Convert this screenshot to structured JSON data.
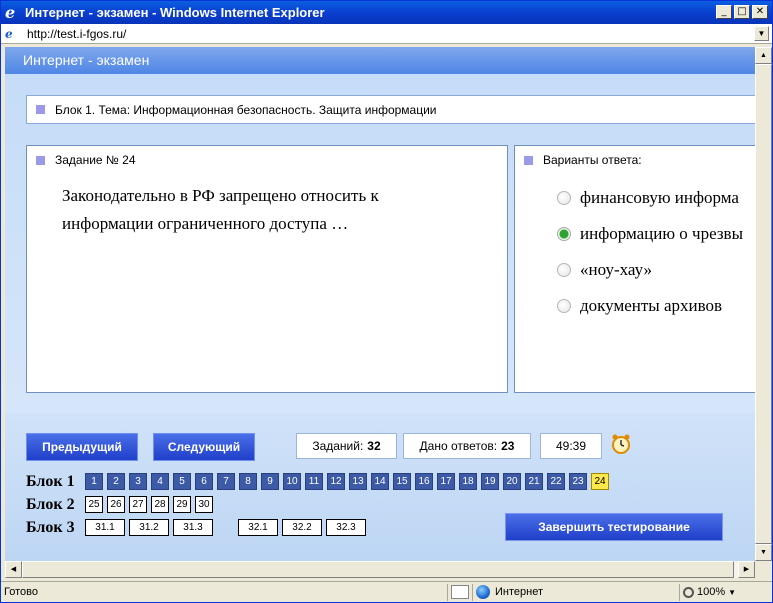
{
  "window": {
    "title": "Интернет - экзамен - Windows Internet Explorer",
    "address": "http://test.i-fgos.ru/"
  },
  "app": {
    "header": "Интернет - экзамен",
    "block_title": "Блок 1. Тема: Информационная безопасность. Защита информации"
  },
  "task": {
    "label": "Задание № 24",
    "question_line1": "Законодательно в РФ запрещено относить к",
    "question_line2": "информации ограниченного доступа …"
  },
  "answers": {
    "label": "Варианты ответа:",
    "options": [
      {
        "text": "финансовую информа",
        "selected": false
      },
      {
        "text": "информацию о чрезвы",
        "selected": true
      },
      {
        "text": "«ноу-хау»",
        "selected": false
      },
      {
        "text": "документы архивов",
        "selected": false
      }
    ]
  },
  "controls": {
    "prev": "Предыдущий",
    "next": "Следующий",
    "tasks_label": "Заданий:",
    "tasks_value": "32",
    "answered_label": "Дано ответов:",
    "answered_value": "23",
    "timer": "49:39",
    "finish": "Завершить тестирование"
  },
  "blocks": [
    {
      "label": "Блок 1",
      "items": [
        "1",
        "2",
        "3",
        "4",
        "5",
        "6",
        "7",
        "8",
        "9",
        "10",
        "11",
        "12",
        "13",
        "14",
        "15",
        "16",
        "17",
        "18",
        "19",
        "20",
        "21",
        "22",
        "23",
        "24"
      ],
      "current": "24"
    },
    {
      "label": "Блок 2",
      "items": [
        "25",
        "26",
        "27",
        "28",
        "29",
        "30"
      ]
    },
    {
      "label": "Блок 3",
      "items": [
        "31.1",
        "31.2",
        "31.3",
        "32.1",
        "32.2",
        "32.3"
      ]
    }
  ],
  "statusbar": {
    "status": "Готово",
    "zone": "Интернет",
    "zoom": "100%"
  }
}
